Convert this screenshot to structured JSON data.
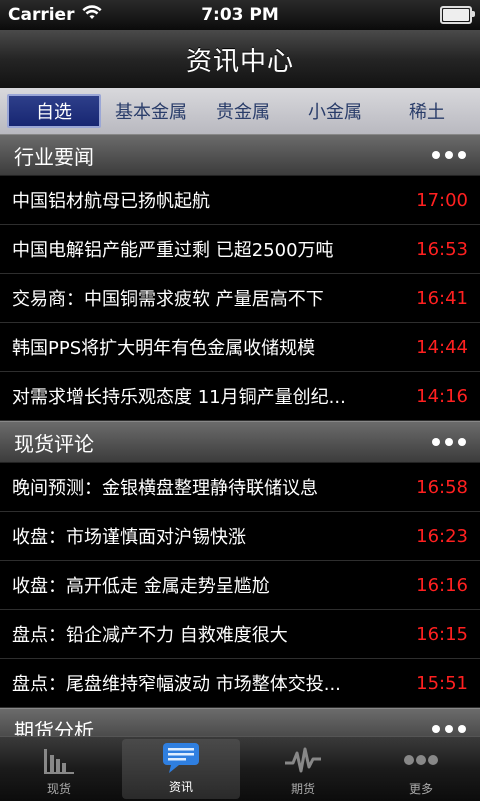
{
  "status_bar": {
    "carrier": "Carrier",
    "time": "7:03 PM"
  },
  "nav": {
    "title": "资讯中心"
  },
  "segments": [
    {
      "label": "自选",
      "active": true
    },
    {
      "label": "基本金属",
      "active": false
    },
    {
      "label": "贵金属",
      "active": false
    },
    {
      "label": "小金属",
      "active": false
    },
    {
      "label": "稀土",
      "active": false
    }
  ],
  "sections": [
    {
      "title": "行业要闻",
      "items": [
        {
          "title": "中国铝材航母已扬帆起航",
          "time": "17:00"
        },
        {
          "title": "中国电解铝产能严重过剩 已超2500万吨",
          "time": "16:53"
        },
        {
          "title": "交易商：中国铜需求疲软 产量居高不下",
          "time": "16:41"
        },
        {
          "title": "韩国PPS将扩大明年有色金属收储规模",
          "time": "14:44"
        },
        {
          "title": "对需求增长持乐观态度 11月铜产量创纪...",
          "time": "14:16"
        }
      ]
    },
    {
      "title": "现货评论",
      "items": [
        {
          "title": "晚间预测：金银横盘整理静待联储议息",
          "time": "16:58"
        },
        {
          "title": "收盘：市场谨慎面对沪锡快涨",
          "time": "16:23"
        },
        {
          "title": "收盘：高开低走 金属走势呈尴尬",
          "time": "16:16"
        },
        {
          "title": "盘点：铅企减产不力 自救难度很大",
          "time": "16:15"
        },
        {
          "title": "盘点：尾盘维持窄幅波动  市场整体交投...",
          "time": "15:51"
        }
      ]
    },
    {
      "title": "期货分析",
      "items": []
    }
  ],
  "tab_bar": [
    {
      "label": "现货",
      "icon": "bar-chart-icon",
      "active": false
    },
    {
      "label": "资讯",
      "icon": "chat-bubble-icon",
      "active": true
    },
    {
      "label": "期货",
      "icon": "pulse-icon",
      "active": false
    },
    {
      "label": "更多",
      "icon": "more-icon",
      "active": false
    }
  ]
}
